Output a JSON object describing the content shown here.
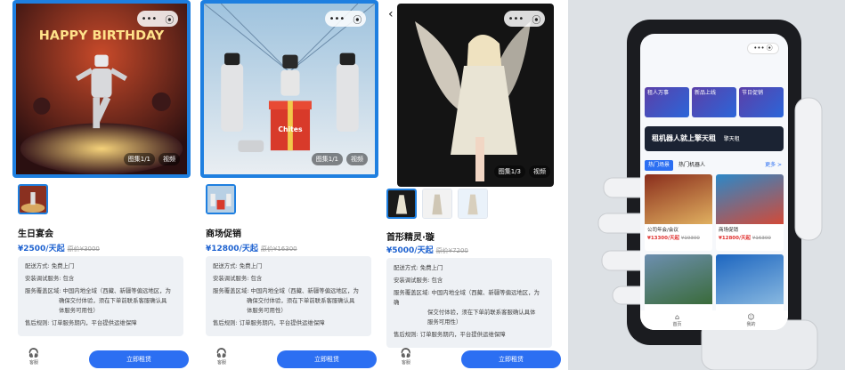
{
  "colors": {
    "accent": "#1e7fe0",
    "button": "#2c6ff2",
    "price": "#1e62d0",
    "info_bg": "#eef1f5"
  },
  "icons": {
    "capsule": [
      "more-dots-icon",
      "target-icon"
    ],
    "service": "headset-icon",
    "back": "chevron-left-icon"
  },
  "capsule": {
    "dots": "•••",
    "target": "⦿"
  },
  "back_glyph": "‹",
  "service_glyph": "🎧",
  "products": [
    {
      "hero_text": "HAPPY BIRTHDAY",
      "tag_gallery": "图集1/1",
      "tag_video": "视频",
      "title": "生日宴会",
      "price": "¥2500/天起",
      "original_price": "原价¥3000",
      "info": {
        "delivery": "配送方式: 免费上门",
        "setup": "安装调试服务: 包含",
        "coverage": "服务覆盖区域: 中国内地全域（西藏、新疆等偏远地区，为",
        "coverage_2": "确保交付体验，须在下单前联系客服确认具",
        "coverage_3": "体服务可用性）",
        "after": "售后规则: 订单服务期内，平台提供运维保障"
      },
      "service_label": "客服",
      "button": "立即租赁"
    },
    {
      "hero_text": "Chites",
      "tag_gallery": "图集1/1",
      "tag_video": "视频",
      "title": "商场促销",
      "price": "¥12800/天起",
      "original_price": "原价¥16300",
      "info": {
        "delivery": "配送方式: 免费上门",
        "setup": "安装调试服务: 包含",
        "coverage": "服务覆盖区域: 中国内地全域（西藏、新疆等偏远地区，为",
        "coverage_2": "确保交付体验，须在下单前联系客服确认具",
        "coverage_3": "体服务可用性）",
        "after": "售后规则: 订单服务期内，平台提供运维保障"
      },
      "service_label": "客服",
      "button": "立即租赁"
    },
    {
      "tag_gallery": "图集1/3",
      "tag_video": "视频",
      "title": "首形精灵·璇",
      "price": "¥5000/天起",
      "original_price": "原价¥7200",
      "info": {
        "delivery": "配送方式: 免费上门",
        "setup": "安装调试服务: 包含",
        "coverage": "服务覆盖区域: 中国内地全域（西藏、新疆等偏远地区，为确",
        "coverage_2": "保交付体验，须在下单前联系客服确认具体",
        "coverage_3": "服务可用性）",
        "after": "售后规则: 订单服务期内，平台提供运维保障"
      },
      "service_label": "客服",
      "button": "立即租赁"
    }
  ],
  "phone": {
    "capsule": "••• ⦿",
    "banners": [
      "租人万事",
      "新品上线",
      "节日促销"
    ],
    "slogan": "租机器人就上擎天租",
    "brand": "擎天租",
    "tabs": [
      "热门场景",
      "热门机器人"
    ],
    "more": "更多 >",
    "cards": [
      {
        "name": "公司年会/会议",
        "price": "¥13300/天起",
        "original": "¥19300"
      },
      {
        "name": "商场促销",
        "price": "¥12800/天起",
        "original": "¥16300"
      },
      {
        "name": "",
        "price": "",
        "original": ""
      },
      {
        "name": "",
        "price": "",
        "original": ""
      }
    ],
    "nav": [
      "首页",
      "我的"
    ]
  }
}
